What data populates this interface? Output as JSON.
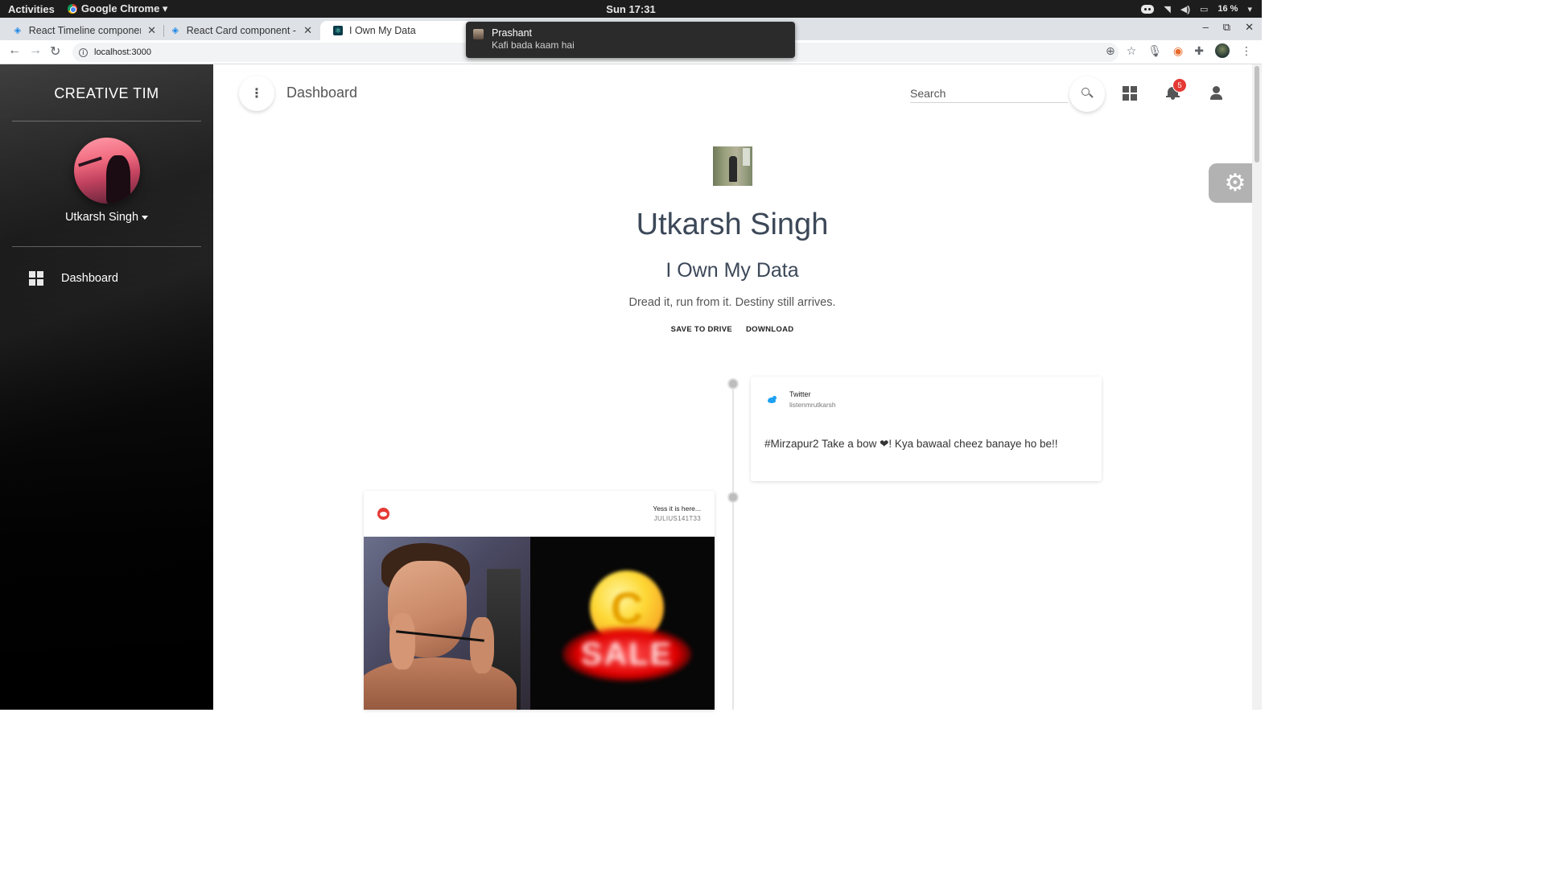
{
  "system_bar": {
    "activities": "Activities",
    "app_name": "Google Chrome ▾",
    "clock": "Sun 17:31",
    "battery": "16 %"
  },
  "browser": {
    "tabs": [
      {
        "title": "React Timeline component",
        "favicon": "mui-icon"
      },
      {
        "title": "React Card component - M",
        "favicon": "mui-icon"
      },
      {
        "title": "I Own My Data",
        "favicon": "react-app-icon",
        "active": true
      }
    ],
    "url": "localhost:3000"
  },
  "notification": {
    "sender": "Prashant",
    "message": "Kafi bada kaam hai"
  },
  "sidebar": {
    "brand": "CREATIVE TIM",
    "user_name": "Utkarsh Singh",
    "items": [
      {
        "label": "Dashboard",
        "icon": "dashboard-icon"
      }
    ]
  },
  "header": {
    "title": "Dashboard",
    "search_placeholder": "Search",
    "notification_count": "5"
  },
  "profile": {
    "name": "Utkarsh Singh",
    "title": "I Own My Data",
    "quote": "Dread it, run from it. Destiny still arrives.",
    "actions": {
      "save": "SAVE TO DRIVE",
      "download": "DOWNLOAD"
    }
  },
  "timeline": [
    {
      "source": "Twitter",
      "user": "listenmrutkarsh",
      "text": "#Mirzapur2 Take a bow ❤! Kya bawaal cheez banaye ho be!!",
      "icon": "twitter-icon"
    },
    {
      "source": "Reddit",
      "title": "Yess it is here...",
      "user": "JULIUS141T33",
      "icon": "reddit-icon",
      "image_text": {
        "coin": "C",
        "sale": "SALE"
      }
    }
  ],
  "colors": {
    "badge": "#e53935",
    "twitter": "#1da1f2",
    "reddit": "#e53935"
  }
}
